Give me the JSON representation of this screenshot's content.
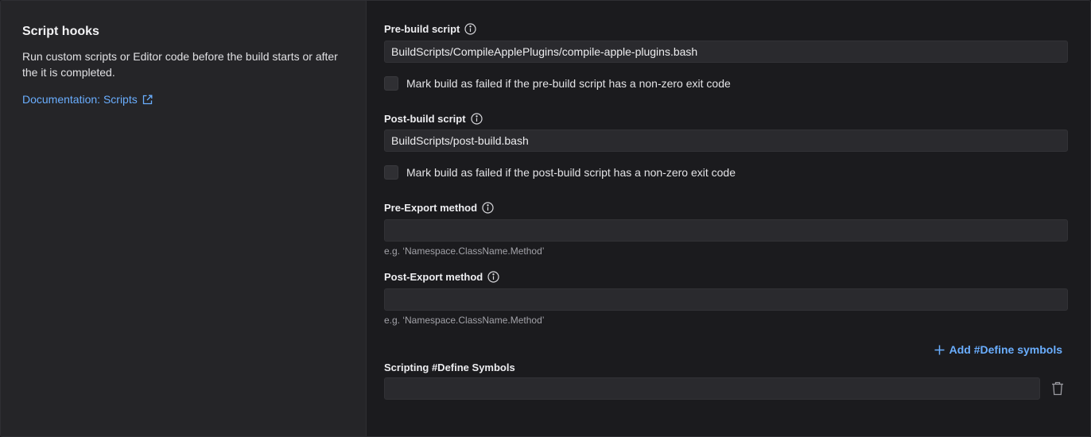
{
  "section": {
    "title": "Script hooks",
    "description": "Run custom scripts or Editor code before the build starts or after the it is completed.",
    "doc_link": "Documentation: Scripts"
  },
  "pre_build": {
    "label": "Pre-build script",
    "value": "BuildScripts/CompileApplePlugins/compile-apple-plugins.bash",
    "checkbox_label": "Mark build as failed if the pre-build script has a non-zero exit code",
    "checked": false
  },
  "post_build": {
    "label": "Post-build script",
    "value": "BuildScripts/post-build.bash",
    "checkbox_label": "Mark build as failed if the post-build script has a non-zero exit code",
    "checked": false
  },
  "pre_export": {
    "label": "Pre-Export method",
    "value": "",
    "hint": "e.g. ‘Namespace.ClassName.Method’"
  },
  "post_export": {
    "label": "Post-Export method",
    "value": "",
    "hint": "e.g. ‘Namespace.ClassName.Method’"
  },
  "define_symbols": {
    "add_label": "Add #Define symbols",
    "label": "Scripting #Define Symbols",
    "value": ""
  },
  "icons": {
    "info": "info-icon",
    "external_link": "external-link-icon",
    "plus": "plus-icon",
    "trash": "trash-icon"
  },
  "colors": {
    "accent": "#6aaeff",
    "left_panel": "#252528",
    "right_panel": "#1b1b1e",
    "input_bg": "#2a2a2e"
  }
}
